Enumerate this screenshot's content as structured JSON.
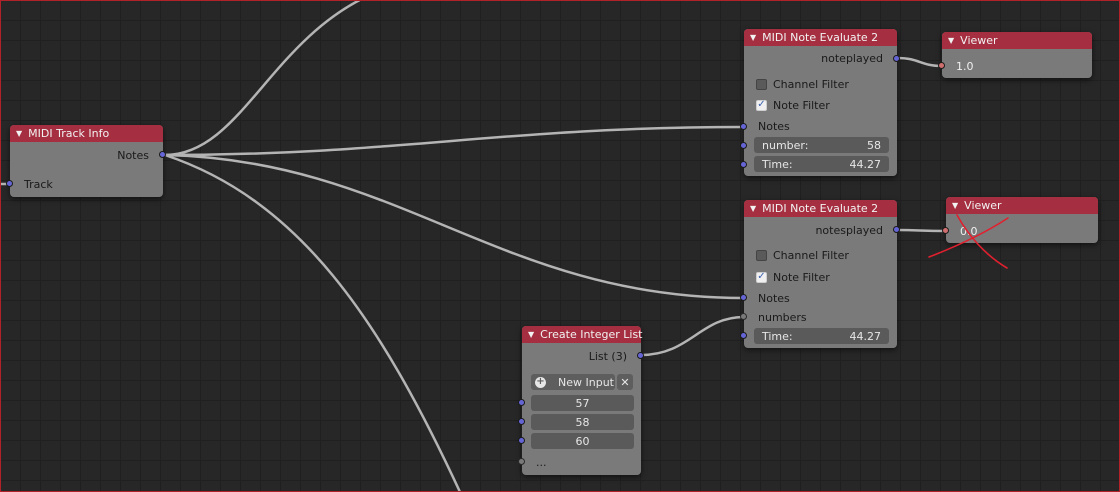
{
  "nodes": {
    "track_info": {
      "title": "MIDI Track Info",
      "outputs": [
        "Notes"
      ],
      "inputs": [
        "Track"
      ]
    },
    "eval1": {
      "title": "MIDI Note Evaluate 2",
      "output": "noteplayed",
      "channel_filter": {
        "label": "Channel Filter",
        "checked": false
      },
      "note_filter": {
        "label": "Note Filter",
        "checked": true
      },
      "inputs": {
        "notes": "Notes",
        "number_label": "number:",
        "number_value": "58",
        "time_label": "Time:",
        "time_value": "44.27"
      }
    },
    "viewer1": {
      "title": "Viewer",
      "value": "1.0"
    },
    "eval2": {
      "title": "MIDI Note Evaluate 2",
      "output": "notesplayed",
      "channel_filter": {
        "label": "Channel Filter",
        "checked": false
      },
      "note_filter": {
        "label": "Note Filter",
        "checked": true
      },
      "inputs": {
        "notes": "Notes",
        "numbers": "numbers",
        "time_label": "Time:",
        "time_value": "44.27"
      }
    },
    "viewer2": {
      "title": "Viewer",
      "value": "0.0"
    },
    "int_list": {
      "title": "Create Integer List",
      "output": "List (3)",
      "new_input": "New Input",
      "values": [
        "57",
        "58",
        "60"
      ],
      "more": "..."
    }
  },
  "icons": {
    "collapse": "triangle-down",
    "check": "checkmark",
    "add": "plus-circle",
    "remove": "x-mark"
  },
  "colors": {
    "header": "#a52f40",
    "node_body": "#7a7a7a",
    "link": "#b4b4b4",
    "socket_data": "#6565d6",
    "socket_generic": "#cf6e6e",
    "annotation": "#e0202e",
    "background": "#272727"
  },
  "check_glyph": "✓",
  "arrow_glyph": "▼",
  "close_glyph": "✕",
  "plus_glyph": "+"
}
